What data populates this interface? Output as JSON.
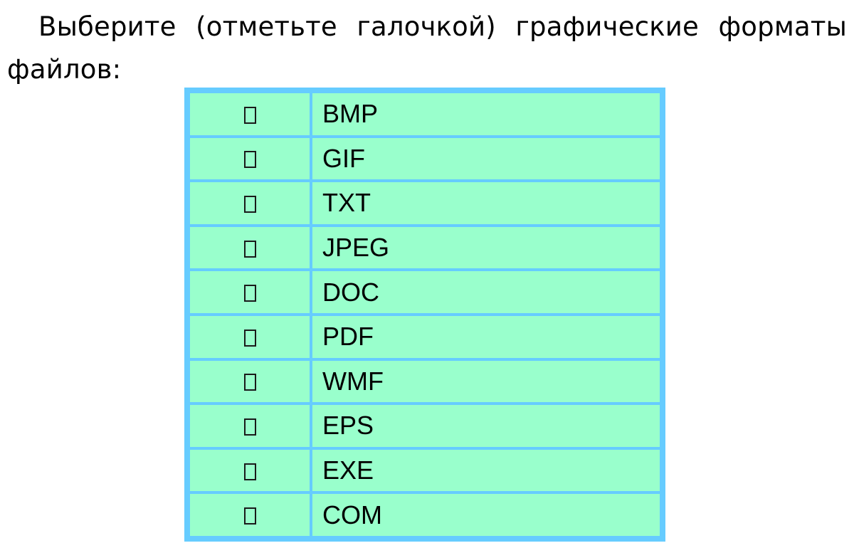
{
  "question": {
    "text": "Выберите (отметьте галочкой) графические форматы файлов:"
  },
  "colors": {
    "cell_fill": "#99ffcc",
    "grid_border": "#66ccff",
    "text": "#000000"
  },
  "table": {
    "checkbox_icon": "empty-square-checkbox",
    "rows": [
      {
        "label": "BMP",
        "checked": false
      },
      {
        "label": "GIF",
        "checked": false
      },
      {
        "label": "TXT",
        "checked": false
      },
      {
        "label": "JPEG",
        "checked": false
      },
      {
        "label": "DOC",
        "checked": false
      },
      {
        "label": "PDF",
        "checked": false
      },
      {
        "label": "WMF",
        "checked": false
      },
      {
        "label": "EPS",
        "checked": false
      },
      {
        "label": "EXE",
        "checked": false
      },
      {
        "label": "COM",
        "checked": false
      }
    ]
  }
}
